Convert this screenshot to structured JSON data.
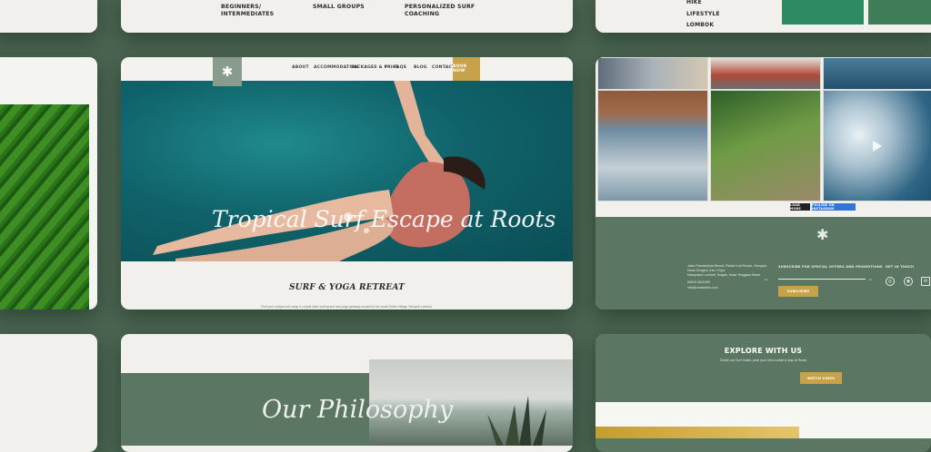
{
  "top_card": {
    "features": [
      "BEGINNERS/ INTERMEDIATES",
      "SMALL GROUPS",
      "PERSONALIZED SURF COACHING"
    ]
  },
  "top_right_card": {
    "list": [
      "HIKE",
      "LIFESTYLE",
      "LOMBOK"
    ]
  },
  "main_card": {
    "nav": [
      "ABOUT",
      "ACCOMMODATION",
      "PACKAGES & PRICE",
      "FAQS",
      "BLOG",
      "CONTACT"
    ],
    "book_now": "BOOK NOW",
    "hero_title": "Tropical Surf Escape at Roots",
    "section_title": "SURF & YOGA RETREAT",
    "blurb": "Find your unique surf camp & crystal clear surfing surf and yoga getaway located in the small Surfer Village Gerupuk Lombok."
  },
  "right_card": {
    "buttons": {
      "learn_more": "LOAD MORE",
      "instagram": "FOLLOW ON INSTAGRAM"
    },
    "address": [
      "Jalan Pandanlima Resort, Pantai Kuti Rondo, Gerupuk,",
      "Desa Sengkol, Kec. Pujut,",
      "Kabupaten Lombok Tengah, Nusa Tenggara Barat"
    ],
    "phone": "62819 4611990",
    "email": "info@rootsvibes.com",
    "subscribe_label": "SUBSCRIBE FOR SPECIAL OFFERS AND PROMOTIONS",
    "subscribe_button": "SUBSCRIBE",
    "get_in_touch": "GET IN TOUCH"
  },
  "bottom_card": {
    "philosophy": "Our Philosophy"
  },
  "bottom_right_card": {
    "title": "EXPLORE WITH US",
    "subtitle": "Check our Surf Guide, plan your next surfari & stay at Roots",
    "button": "WATCH VIDEO"
  }
}
